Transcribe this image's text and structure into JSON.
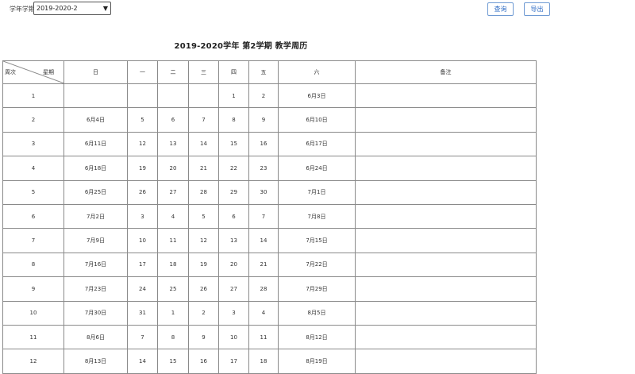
{
  "toolbar": {
    "term_label": "学年学期：",
    "term_value": "2019-2020-2",
    "query_label": "查询",
    "export_label": "导出"
  },
  "title": "2019-2020学年  第2学期   教学周历",
  "table": {
    "corner_week": "周次",
    "corner_day": "星期",
    "headers": [
      "日",
      "一",
      "二",
      "三",
      "四",
      "五",
      "六",
      "备注"
    ],
    "rows": [
      {
        "week": "1",
        "days": [
          "",
          "",
          "",
          "",
          "1",
          "2",
          "6月3日"
        ],
        "note": ""
      },
      {
        "week": "2",
        "days": [
          "6月4日",
          "5",
          "6",
          "7",
          "8",
          "9",
          "6月10日"
        ],
        "note": ""
      },
      {
        "week": "3",
        "days": [
          "6月11日",
          "12",
          "13",
          "14",
          "15",
          "16",
          "6月17日"
        ],
        "note": ""
      },
      {
        "week": "4",
        "days": [
          "6月18日",
          "19",
          "20",
          "21",
          "22",
          "23",
          "6月24日"
        ],
        "note": ""
      },
      {
        "week": "5",
        "days": [
          "6月25日",
          "26",
          "27",
          "28",
          "29",
          "30",
          "7月1日"
        ],
        "note": ""
      },
      {
        "week": "6",
        "days": [
          "7月2日",
          "3",
          "4",
          "5",
          "6",
          "7",
          "7月8日"
        ],
        "note": ""
      },
      {
        "week": "7",
        "days": [
          "7月9日",
          "10",
          "11",
          "12",
          "13",
          "14",
          "7月15日"
        ],
        "note": ""
      },
      {
        "week": "8",
        "days": [
          "7月16日",
          "17",
          "18",
          "19",
          "20",
          "21",
          "7月22日"
        ],
        "note": ""
      },
      {
        "week": "9",
        "days": [
          "7月23日",
          "24",
          "25",
          "26",
          "27",
          "28",
          "7月29日"
        ],
        "note": ""
      },
      {
        "week": "10",
        "days": [
          "7月30日",
          "31",
          "1",
          "2",
          "3",
          "4",
          "8月5日"
        ],
        "note": ""
      },
      {
        "week": "11",
        "days": [
          "8月6日",
          "7",
          "8",
          "9",
          "10",
          "11",
          "8月12日"
        ],
        "note": ""
      },
      {
        "week": "12",
        "days": [
          "8月13日",
          "14",
          "15",
          "16",
          "17",
          "18",
          "8月19日"
        ],
        "note": ""
      }
    ]
  }
}
